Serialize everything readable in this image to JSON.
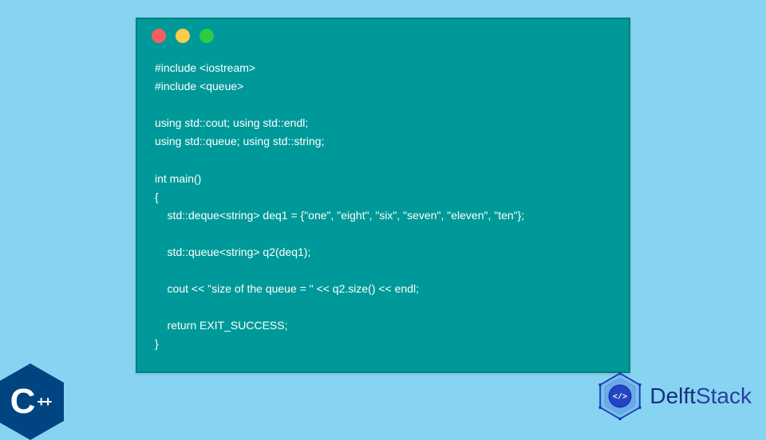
{
  "code": {
    "lines": [
      "#include <iostream>",
      "#include <queue>",
      "",
      "using std::cout; using std::endl;",
      "using std::queue; using std::string;",
      "",
      "int main()",
      "{",
      "    std::deque<string> deq1 = {\"one\", \"eight\", \"six\", \"seven\", \"eleven\", \"ten\"};",
      "",
      "    std::queue<string> q2(deq1);",
      "",
      "    cout << \"size of the queue = \" << q2.size() << endl;",
      "",
      "    return EXIT_SUCCESS;",
      "}"
    ]
  },
  "window_dots": {
    "red": "#f25f5c",
    "yellow": "#ffcb47",
    "green": "#2ecc40"
  },
  "cpp_badge": {
    "letter": "C",
    "suffix": "++"
  },
  "brand": {
    "part1": "Delft",
    "part2": "Stack"
  }
}
